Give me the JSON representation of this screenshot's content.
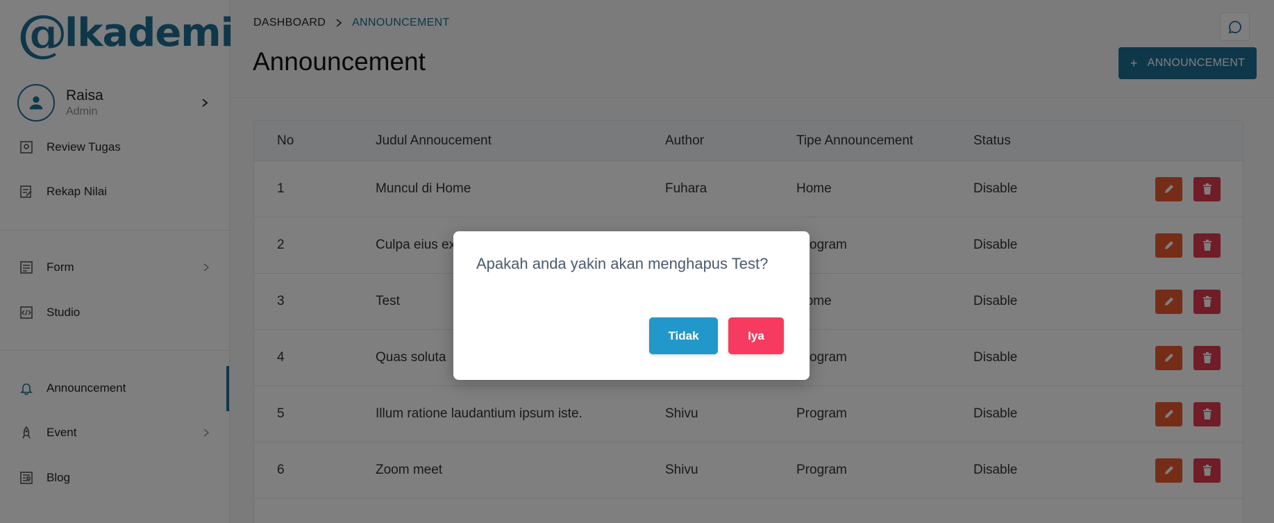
{
  "brand": {
    "logo_mark": "@",
    "logo_word": "lkademi",
    "color": "#1f6f95"
  },
  "user": {
    "name": "Raisa",
    "role": "Admin"
  },
  "sidebar": {
    "items": [
      {
        "label": "Review Tugas",
        "icon": "review-icon"
      },
      {
        "label": "Rekap Nilai",
        "icon": "rekap-icon"
      },
      {
        "label": "Form",
        "icon": "form-icon",
        "has_submenu": true
      },
      {
        "label": "Studio",
        "icon": "code-icon"
      },
      {
        "label": "Announcement",
        "icon": "bell-icon",
        "active": true
      },
      {
        "label": "Event",
        "icon": "rocket-icon",
        "has_submenu": true
      },
      {
        "label": "Blog",
        "icon": "blog-icon"
      }
    ]
  },
  "breadcrumb": {
    "home": "DASHBOARD",
    "current": "ANNOUNCEMENT"
  },
  "page": {
    "title": "Announcement",
    "add_button": "ANNOUNCEMENT",
    "add_icon": "+"
  },
  "table": {
    "headers": [
      "No",
      "Judul Annoucement",
      "Author",
      "Tipe Announcement",
      "Status"
    ],
    "rows": [
      {
        "no": "1",
        "judul": "Muncul di Home",
        "author": "Fuhara",
        "tipe": "Home",
        "status": "Disable"
      },
      {
        "no": "2",
        "judul": "Culpa eius ex",
        "author": "",
        "tipe": "Program",
        "status": "Disable"
      },
      {
        "no": "3",
        "judul": "Test",
        "author": "",
        "tipe": "Home",
        "status": "Disable"
      },
      {
        "no": "4",
        "judul": "Quas soluta",
        "author": "",
        "tipe": "Program",
        "status": "Disable"
      },
      {
        "no": "5",
        "judul": "Illum ratione laudantium ipsum iste.",
        "author": "Shivu",
        "tipe": "Program",
        "status": "Disable"
      },
      {
        "no": "6",
        "judul": "Zoom meet",
        "author": "Shivu",
        "tipe": "Program",
        "status": "Disable"
      }
    ]
  },
  "modal": {
    "message": "Apakah anda yakin akan menghapus Test?",
    "cancel": "Tidak",
    "confirm": "Iya"
  },
  "colors": {
    "primary": "#1f6f95",
    "edit": "#ea5a2e",
    "delete": "#e03a4f",
    "cancel": "#2297c9",
    "confirm": "#f73b60"
  }
}
